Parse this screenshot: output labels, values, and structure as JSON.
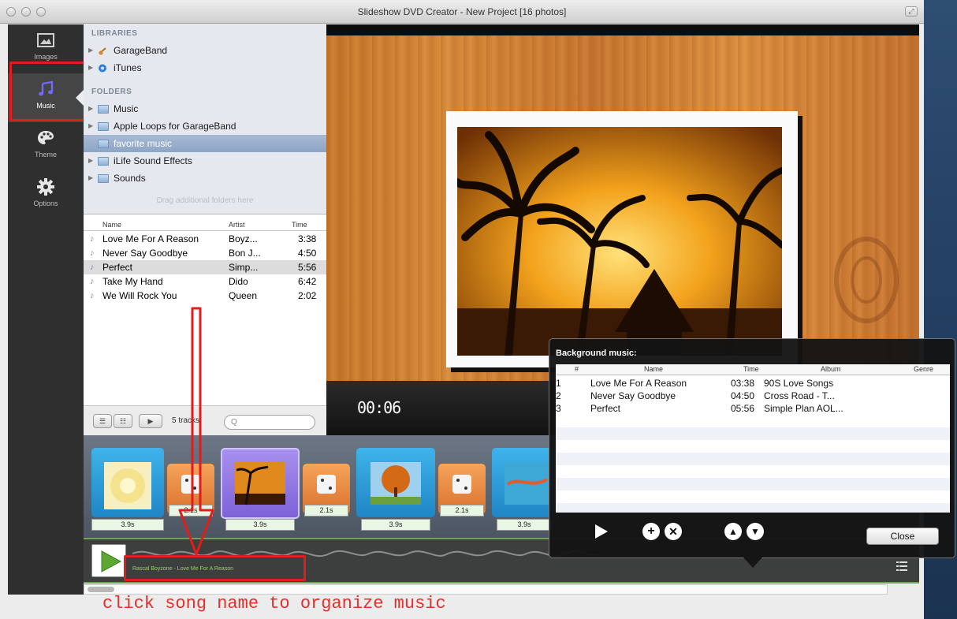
{
  "window": {
    "title": "Slideshow DVD Creator - New Project [16 photos]"
  },
  "sidebar": {
    "items": [
      {
        "label": "Images",
        "icon": "image-icon"
      },
      {
        "label": "Music",
        "icon": "music-note-icon"
      },
      {
        "label": "Theme",
        "icon": "palette-icon"
      },
      {
        "label": "Options",
        "icon": "gear-icon"
      }
    ],
    "active": "Music"
  },
  "libraries": {
    "title": "LIBRARIES",
    "items": [
      "GarageBand",
      "iTunes"
    ]
  },
  "folders": {
    "title": "FOLDERS",
    "items": [
      "Music",
      "Apple Loops for GarageBand",
      "favorite music",
      "iLife Sound Effects",
      "Sounds"
    ],
    "selected": "favorite music",
    "drag_hint": "Drag additional folders here"
  },
  "tracks": {
    "columns": [
      "Name",
      "Artist",
      "Time"
    ],
    "rows": [
      {
        "name": "Love Me For A Reason",
        "artist": "Boyz...",
        "time": "3:38"
      },
      {
        "name": "Never Say Goodbye",
        "artist": "Bon J...",
        "time": "4:50"
      },
      {
        "name": "Perfect",
        "artist": "Simp...",
        "time": "5:56"
      },
      {
        "name": "Take My Hand",
        "artist": "Dido",
        "time": "6:42"
      },
      {
        "name": "We Will Rock You",
        "artist": "Queen",
        "time": "2:02"
      }
    ],
    "selected_index": 2,
    "count_label": "5 tracks"
  },
  "search": {
    "placeholder": "Q"
  },
  "preview": {
    "timecode": "00:06"
  },
  "storyboard": {
    "durations": [
      "3.9s",
      "2.1s",
      "3.9s",
      "2.1s",
      "3.9s",
      "2.1s",
      "3.9s"
    ]
  },
  "audio_track": {
    "song_label": "Rascal Boyzone - Love Me For A Reason"
  },
  "background_music": {
    "title": "Background music:",
    "columns": [
      "#",
      "Name",
      "Time",
      "Album",
      "Genre"
    ],
    "rows": [
      {
        "num": "1",
        "name": "Love Me For A Reason",
        "time": "03:38",
        "album": "90S Love Songs",
        "genre": ""
      },
      {
        "num": "2",
        "name": "Never Say Goodbye",
        "time": "04:50",
        "album": "Cross Road - T...",
        "genre": ""
      },
      {
        "num": "3",
        "name": "Perfect",
        "time": "05:56",
        "album": "Simple Plan AOL...",
        "genre": ""
      }
    ],
    "close_label": "Close"
  },
  "annotation": {
    "text": "click song name to organize music",
    "color": "#ec2b2b"
  },
  "colors": {
    "accent_red": "#e21c1c",
    "sidebar_bg": "#2f2f2f",
    "wave_green": "#6ea35a"
  }
}
